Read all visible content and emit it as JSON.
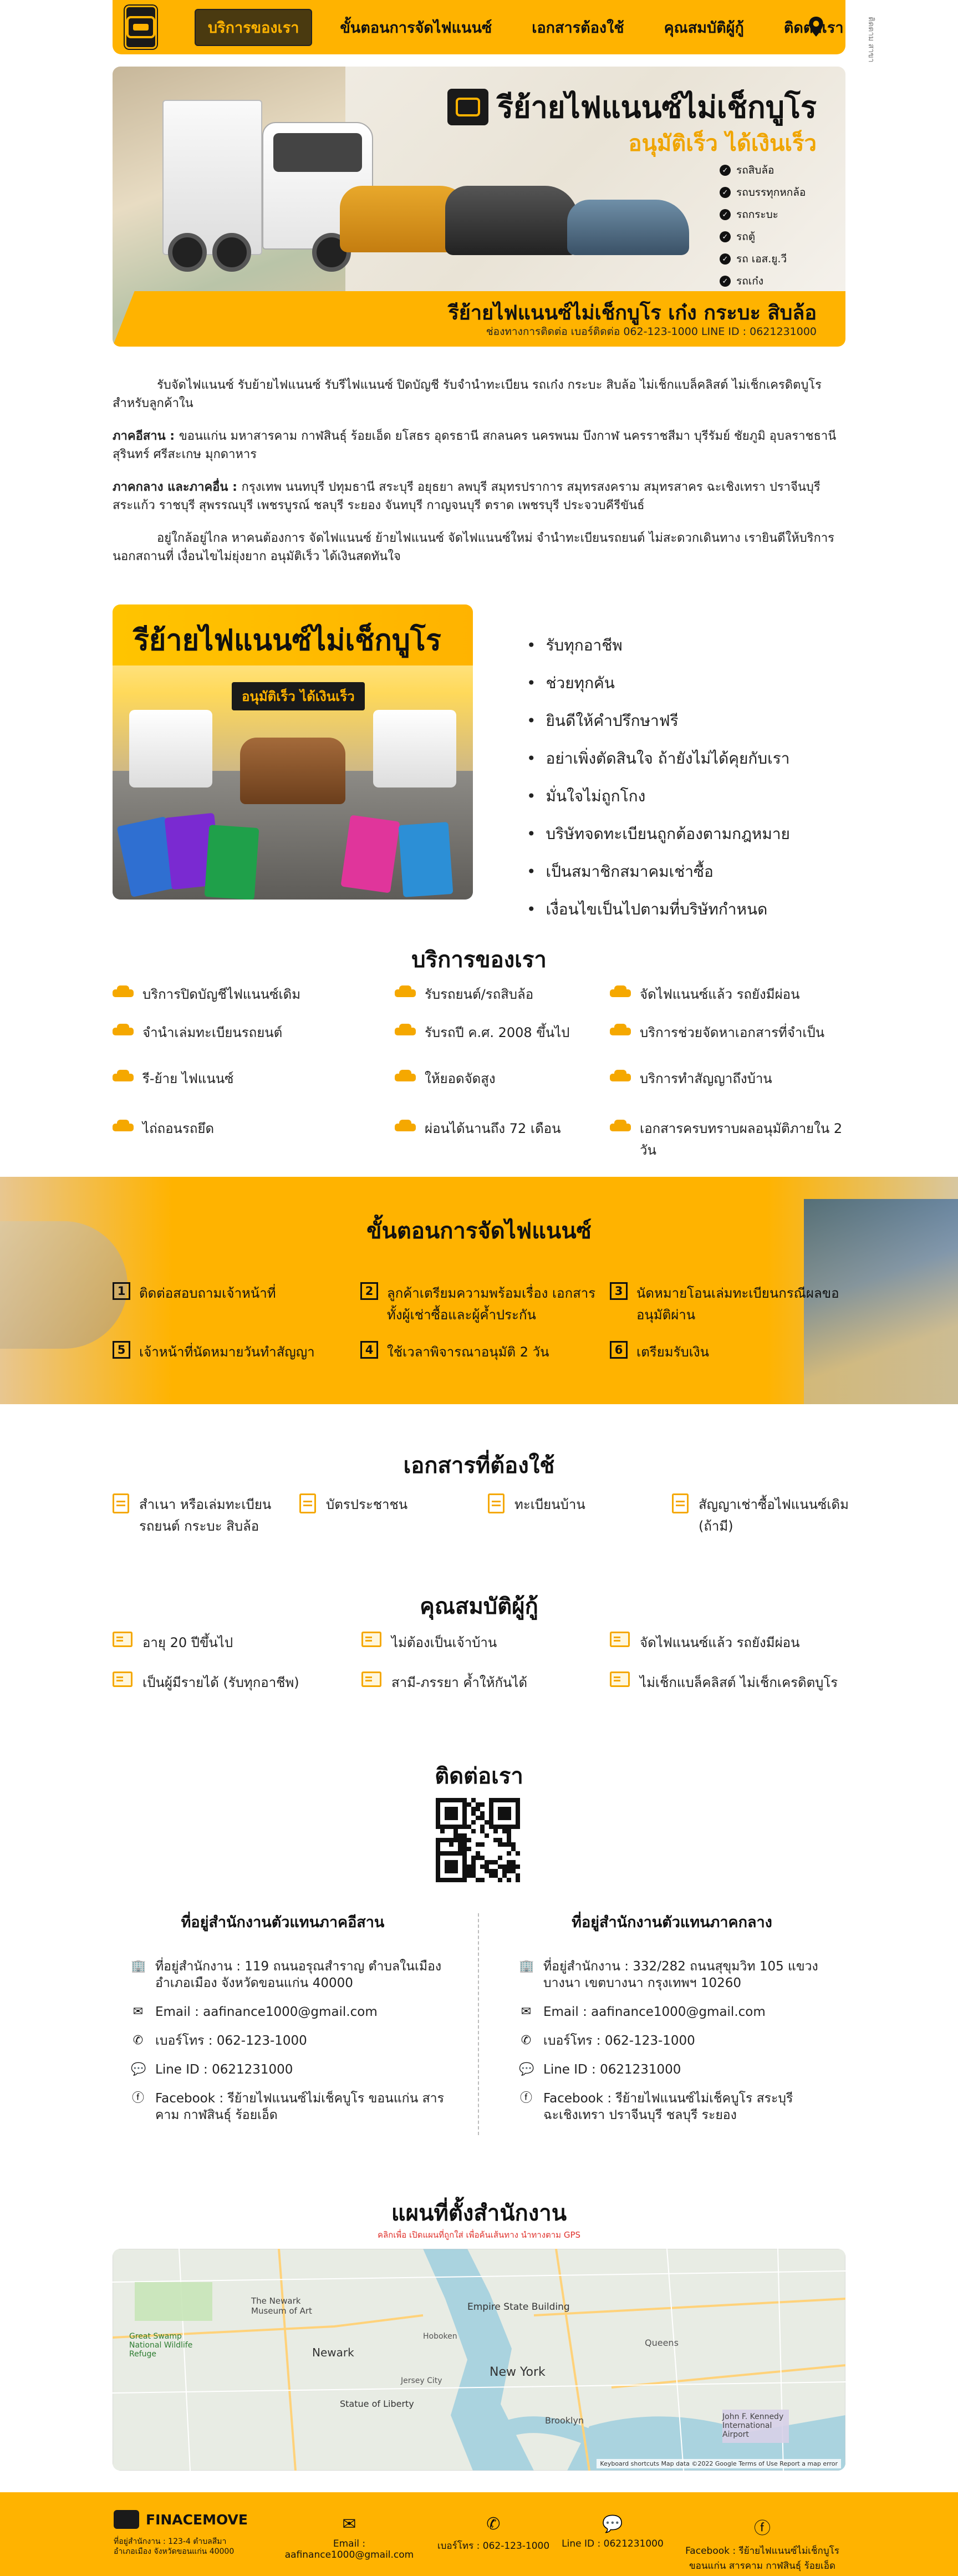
{
  "nav": {
    "items": [
      "บริการของเรา",
      "ขั้นตอนการจัดไฟแนนซ์",
      "เอกสารต้องใช้",
      "คุณสมบัติผู้กู้",
      "ติดต่อเรา"
    ],
    "side_text": "ติดตาม สาขา"
  },
  "hero": {
    "title": "รีย้ายไฟแนนซ์ไม่เช็กบูโร",
    "subtitle": "อนุมัติเร็ว ได้เงินเร็ว",
    "list": [
      "รถสิบล้อ",
      "รถบรรทุกหกล้อ",
      "รถกระบะ",
      "รถตู้",
      "รถ เอส.ยู.วี",
      "รถเก๋ง"
    ],
    "band_title": "รีย้ายไฟแนนซ์ไม่เช็กบูโร เก๋ง กระบะ สิบล้อ",
    "band_sub": "ช่องทางการติดต่อ เบอร์ติดต่อ 062-123-1000 LINE ID : 0621231000"
  },
  "intro": {
    "p1": "รับจัดไฟแนนซ์ รับย้ายไฟแนนซ์ รับรีไฟแนนซ์ ปิดบัญชี รับจำนำทะเบียน รถเก๋ง กระบะ สิบล้อ ไม่เช็กแบล็คลิสต์ ไม่เช็กเครดิตบูโร สำหรับลูกค้าใน",
    "p2_label": "ภาคอีสาน : ",
    "p2": "ขอนแก่น มหาสารคาม กาฬสินธุ์ ร้อยเอ็ด ยโสธร อุดรธานี สกลนคร นครพนม บึงกาฬ นครราชสีมา บุรีรัมย์ ชัยภูมิ อุบลราชธานี สุรินทร์ ศรีสะเกษ มุกดาหาร",
    "p3_label": "ภาคกลาง และภาคอื่น : ",
    "p3": "กรุงเทพ นนทบุรี ปทุมธานี สระบุรี อยุธยา ลพบุรี สมุทรปราการ สมุทรสงคราม สมุทรสาคร ฉะเชิงเทรา ปราจีนบุรี สระแก้ว ราชบุรี สุพรรณบุรี เพชรบูรณ์ ชลบุรี ระยอง จันทบุรี กาญจนบุรี ตราด เพชรบุรี ประจวบคีรีขันธ์",
    "p4": "อยู่ใกล้อยู่ไกล หาคนต้องการ จัดไฟแนนซ์ ย้ายไฟแนนซ์ จัดไฟแนนซ์ใหม่ จำนำทะเบียนรถยนต์ ไม่สะดวกเดินทาง เรายินดีให้บริการนอกสถานที่ เงื่อนไขไม่ยุ่งยาก อนุมัติเร็ว ได้เงินสดทันใจ"
  },
  "promo": {
    "title": "รีย้ายไฟแนนซ์ไม่เช็กบูโร",
    "badge": "อนุมัติเร็ว ได้เงินเร็ว"
  },
  "features": [
    "รับทุกอาชีพ",
    "ช่วยทุกคัน",
    "ยินดีให้คำปรึกษาฟรี",
    "อย่าเพิ่งตัดสินใจ ถ้ายังไม่ได้คุยกับเรา",
    "มั่นใจไม่ถูกโกง",
    "บริษัทจดทะเบียนถูกต้องตามกฎหมาย",
    "เป็นสมาชิกสมาคมเช่าซื้อ",
    "เงื่อนไขเป็นไปตามที่บริษัทกำหนด"
  ],
  "services": {
    "title": "บริการของเรา",
    "items": [
      "บริการปิดบัญชีไฟแนนซ์เดิม",
      "รับรถยนต์/รถสิบล้อ",
      "จัดไฟแนนซ์แล้ว รถยังมีผ่อน",
      "จำนำเล่มทะเบียนรถยนต์",
      "รับรถปี ค.ศ. 2008 ขึ้นไป",
      "บริการช่วยจัดหาเอกสารที่จำเป็น",
      "รี-ย้าย ไฟแนนซ์",
      "ให้ยอดจัดสูง",
      "บริการทำสัญญาถึงบ้าน",
      "ไถ่ถอนรถยึด",
      "ผ่อนได้นานถึง 72 เดือน",
      "เอกสารครบทราบผลอนุมัติภายใน 2 วัน"
    ]
  },
  "steps": {
    "title": "ขั้นตอนการจัดไฟแนนซ์",
    "items": [
      {
        "num": "1",
        "text": "ติดต่อสอบถามเจ้าหน้าที่"
      },
      {
        "num": "2",
        "text": "ลูกค้าเตรียมความพร้อมเรื่อง เอกสารทั้งผู้เช่าซื้อและผู้ค้ำประกัน"
      },
      {
        "num": "3",
        "text": "นัดหมายโอนเล่มทะเบียนกรณีผลขออนุมัติผ่าน"
      },
      {
        "num": "5",
        "text": "เจ้าหน้าที่นัดหมายวันทำสัญญา"
      },
      {
        "num": "4",
        "text": "ใช้เวลาพิจารณาอนุมัติ 2 วัน"
      },
      {
        "num": "6",
        "text": "เตรียมรับเงิน"
      }
    ]
  },
  "documents": {
    "title": "เอกสารที่ต้องใช้",
    "items": [
      "สำเนา หรือเล่มทะเบียนรถยนต์ กระบะ สิบล้อ",
      "บัตรประชาชน",
      "ทะเบียนบ้าน",
      "สัญญาเช่าซื้อไฟแนนซ์เดิม (ถ้ามี)"
    ]
  },
  "qualifications": {
    "title": "คุณสมบัติผู้กู้",
    "items": [
      "อายุ 20 ปีขึ้นไป",
      "ไม่ต้องเป็นเจ้าบ้าน",
      "จัดไฟแนนซ์แล้ว รถยังมีผ่อน",
      "เป็นผู้มีรายได้ (รับทุกอาชีพ)",
      "สามี-ภรรยา ค้ำให้กันได้",
      "ไม่เช็กแบล็คลิสต์ ไม่เช็กเครดิตบูโร"
    ]
  },
  "contact": {
    "title": "ติดต่อเรา",
    "offices": [
      {
        "title": "ที่อยู่สำนักงานตัวแทนภาคอีสาน",
        "address": "ที่อยู่สำนักงาน : 119 ถนนอรุณสำราญ ตำบลในเมือง อำเภอเมือง จังหวัดขอนแก่น 40000",
        "email": "Email : aafinance1000@gmail.com",
        "phone": "เบอร์โทร : 062-123-1000",
        "line": "Line ID : 0621231000",
        "facebook": "Facebook : รีย้ายไฟแนนซ์ไม่เช็คบูโร ขอนแก่น สารคาม กาฬสินธุ์ ร้อยเอ็ด"
      },
      {
        "title": "ที่อยู่สำนักงานตัวแทนภาคกลาง",
        "address": "ที่อยู่สำนักงาน : 332/282 ถนนสุขุมวิท 105 แขวงบางนา เขตบางนา กรุงเทพฯ 10260",
        "email": "Email : aafinance1000@gmail.com",
        "phone": "เบอร์โทร : 062-123-1000",
        "line": "Line ID : 0621231000",
        "facebook": "Facebook : รีย้ายไฟแนนซ์ไม่เช็คบูโร สระบุรี ฉะเชิงเทรา ปราจีนบุรี ชลบุรี ระยอง"
      }
    ]
  },
  "map": {
    "title": "แผนที่ตั้งสำนักงาน",
    "note": "คลิกเพื่อ เปิดแผนที่ถูกใส่ เพื่อค้นเส้นทาง นำทางตาม GPS",
    "labels": [
      "Empire State Building",
      "The Newark Museum of Art",
      "Newark",
      "Statue of Liberty",
      "New York",
      "Brooklyn",
      "John F. Kennedy International Airport",
      "Hoboken",
      "Jersey City",
      "Queens",
      "Great Swamp National Wildlife Refuge"
    ],
    "attribution": "Keyboard shortcuts   Map data ©2022 Google   Terms of Use   Report a map error"
  },
  "footer": {
    "brand": "FINACEMOVE",
    "address": "ที่อยู่สำนักงาน : 123-4 ตำบลสีมา อำเภอเมือง จังหวัดขอนแก่น 40000",
    "email": "Email : aafinance1000@gmail.com",
    "phone": "เบอร์โทร : 062-123-1000",
    "line": "Line ID : 0621231000",
    "facebook": "Facebook : รีย้ายไฟแนนซ์ไม่เช็กบูโร ขอนแก่น สารคาม กาฬสินธุ์ ร้อยเอ็ด"
  },
  "colors": {
    "accent": "#ffb300",
    "dark": "#111111"
  }
}
